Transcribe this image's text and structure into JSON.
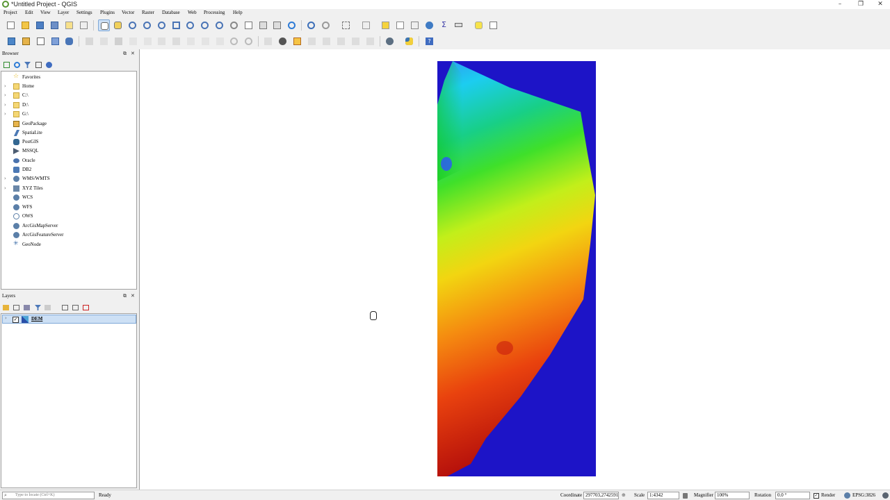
{
  "window": {
    "title": "*Untitled Project - QGIS",
    "minimize": "–",
    "maximize": "❐",
    "close": "✕"
  },
  "menu": [
    "Project",
    "Edit",
    "View",
    "Layer",
    "Settings",
    "Plugins",
    "Vector",
    "Raster",
    "Database",
    "Web",
    "Processing",
    "Help"
  ],
  "browser": {
    "title": "Browser",
    "items": [
      {
        "label": "Favorites",
        "icon": "star-icon",
        "expandable": false
      },
      {
        "label": "Home",
        "icon": "folder-icon",
        "expandable": true
      },
      {
        "label": "C:\\",
        "icon": "folder-icon",
        "expandable": true
      },
      {
        "label": "D:\\",
        "icon": "folder-icon",
        "expandable": true
      },
      {
        "label": "G:\\",
        "icon": "folder-icon",
        "expandable": true
      },
      {
        "label": "GeoPackage",
        "icon": "geopackage-icon",
        "expandable": false
      },
      {
        "label": "SpatiaLite",
        "icon": "spatialite-icon",
        "expandable": false
      },
      {
        "label": "PostGIS",
        "icon": "postgis-icon",
        "expandable": false
      },
      {
        "label": "MSSQL",
        "icon": "mssql-icon",
        "expandable": false
      },
      {
        "label": "Oracle",
        "icon": "oracle-icon",
        "expandable": false
      },
      {
        "label": "DB2",
        "icon": "db2-icon",
        "expandable": false
      },
      {
        "label": "WMS/WMTS",
        "icon": "globe-icon",
        "expandable": true
      },
      {
        "label": "XYZ Tiles",
        "icon": "xyz-tiles-icon",
        "expandable": true
      },
      {
        "label": "WCS",
        "icon": "globe-icon",
        "expandable": false
      },
      {
        "label": "WFS",
        "icon": "globe-icon",
        "expandable": false
      },
      {
        "label": "OWS",
        "icon": "globe-icon",
        "expandable": false
      },
      {
        "label": "ArcGisMapServer",
        "icon": "globe-icon",
        "expandable": false
      },
      {
        "label": "ArcGisFeatureServer",
        "icon": "globe-icon",
        "expandable": false
      },
      {
        "label": "GeoNode",
        "icon": "geonode-icon",
        "expandable": false
      }
    ]
  },
  "layers": {
    "title": "Layers",
    "items": [
      {
        "label": "DEM",
        "checked": true
      }
    ]
  },
  "status": {
    "locator_placeholder": "Type to locate (Ctrl+K)",
    "message": "Ready",
    "coordinate_label": "Coordinate",
    "coordinate_value": "297703,2742591",
    "scale_label": "Scale",
    "scale_value": "1:4342",
    "magnifier_label": "Magnifier",
    "magnifier_value": "100%",
    "rotation_label": "Rotation",
    "rotation_value": "0.0 °",
    "render_label": "Render",
    "crs": "EPSG:3826"
  },
  "colors": {
    "accent": "#3874d1",
    "selection": "#cde0f5",
    "dem_nodata": "#1d14c7"
  }
}
